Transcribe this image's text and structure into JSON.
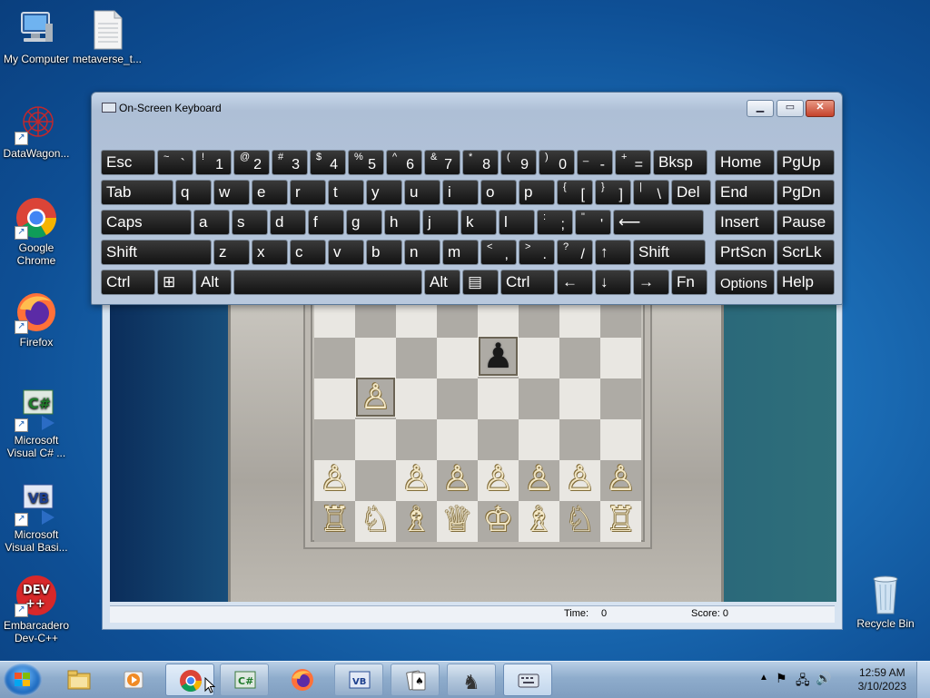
{
  "desktop": {
    "icons": [
      {
        "label": "My Computer"
      },
      {
        "label": "metaverse_t..."
      },
      {
        "label": "DataWagon..."
      },
      {
        "label": "Google Chrome"
      },
      {
        "label": "Firefox"
      },
      {
        "label": "Microsoft Visual C# ..."
      },
      {
        "label": "Microsoft Visual Basi..."
      },
      {
        "label": "Embarcadero Dev-C++"
      },
      {
        "label": "Recycle Bin"
      }
    ]
  },
  "osk": {
    "title": "On-Screen Keyboard",
    "rows": [
      [
        {
          "m": "Esc"
        },
        {
          "s": "~",
          "b": "`"
        },
        {
          "s": "!",
          "b": "1"
        },
        {
          "s": "@",
          "b": "2"
        },
        {
          "s": "#",
          "b": "3"
        },
        {
          "s": "$",
          "b": "4"
        },
        {
          "s": "%",
          "b": "5"
        },
        {
          "s": "^",
          "b": "6"
        },
        {
          "s": "&",
          "b": "7"
        },
        {
          "s": "*",
          "b": "8"
        },
        {
          "s": "(",
          "b": "9"
        },
        {
          "s": ")",
          "b": "0"
        },
        {
          "s": "_",
          "b": "-"
        },
        {
          "s": "+",
          "b": "="
        },
        {
          "m": "Bksp"
        },
        {
          "m": "Home"
        },
        {
          "m": "PgUp"
        }
      ],
      [
        {
          "m": "Tab"
        },
        {
          "m": "q"
        },
        {
          "m": "w"
        },
        {
          "m": "e"
        },
        {
          "m": "r"
        },
        {
          "m": "t"
        },
        {
          "m": "y"
        },
        {
          "m": "u"
        },
        {
          "m": "i"
        },
        {
          "m": "o"
        },
        {
          "m": "p"
        },
        {
          "s": "{",
          "b": "["
        },
        {
          "s": "}",
          "b": "]"
        },
        {
          "s": "|",
          "b": "\\"
        },
        {
          "m": "Del"
        },
        {
          "m": "End"
        },
        {
          "m": "PgDn"
        }
      ],
      [
        {
          "m": "Caps"
        },
        {
          "m": "a"
        },
        {
          "m": "s"
        },
        {
          "m": "d"
        },
        {
          "m": "f"
        },
        {
          "m": "g"
        },
        {
          "m": "h"
        },
        {
          "m": "j"
        },
        {
          "m": "k"
        },
        {
          "m": "l"
        },
        {
          "s": ":",
          "b": ";"
        },
        {
          "s": "\"",
          "b": "'"
        },
        {
          "m": "⟵"
        },
        {
          "m": "Insert"
        },
        {
          "m": "Pause"
        }
      ],
      [
        {
          "m": "Shift"
        },
        {
          "m": "z"
        },
        {
          "m": "x"
        },
        {
          "m": "c"
        },
        {
          "m": "v"
        },
        {
          "m": "b"
        },
        {
          "m": "n"
        },
        {
          "m": "m"
        },
        {
          "s": "<",
          "b": ","
        },
        {
          "s": ">",
          "b": "."
        },
        {
          "s": "?",
          "b": "/"
        },
        {
          "m": "↑"
        },
        {
          "m": "Shift"
        },
        {
          "m": "PrtScn"
        },
        {
          "m": "ScrLk"
        }
      ],
      [
        {
          "m": "Ctrl"
        },
        {
          "m": "⊞"
        },
        {
          "m": "Alt"
        },
        {
          "m": ""
        },
        {
          "m": "Alt"
        },
        {
          "m": "▤"
        },
        {
          "m": "Ctrl"
        },
        {
          "m": "←"
        },
        {
          "m": "↓"
        },
        {
          "m": "→"
        },
        {
          "m": "Fn"
        },
        {
          "m": "Options"
        },
        {
          "m": "Help"
        }
      ]
    ]
  },
  "chess": {
    "status": {
      "time_label": "Time:",
      "time_value": "0",
      "score_label": "Score: 0"
    }
  },
  "taskbar": {
    "clock_time": "12:59 AM",
    "clock_date": "3/10/2023"
  }
}
